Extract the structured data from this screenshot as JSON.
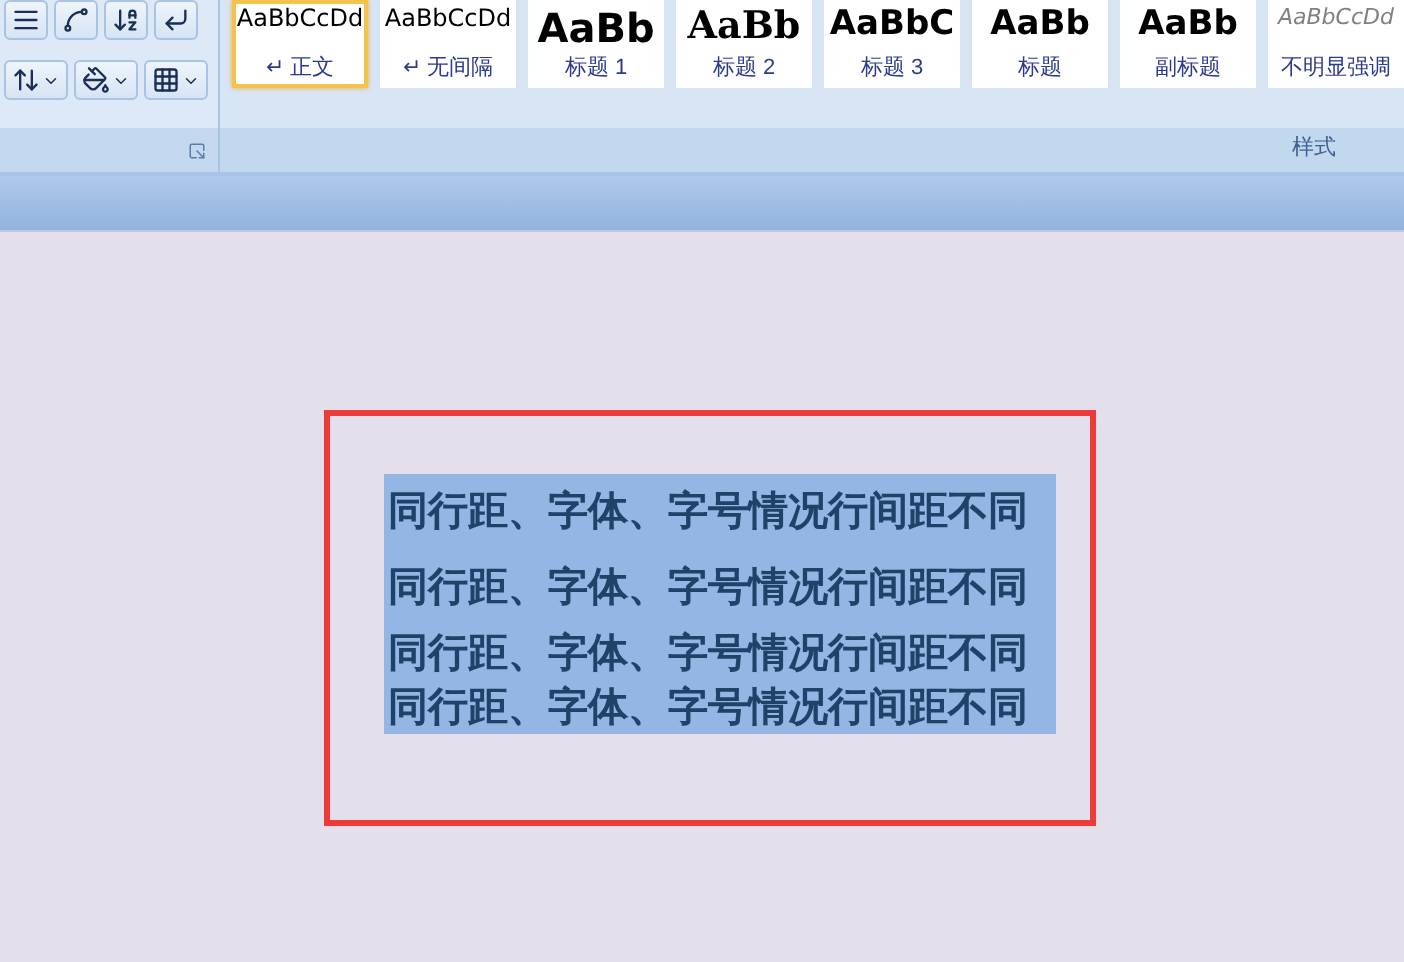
{
  "ribbon": {
    "paragraph_group": {
      "rows": [
        [
          {
            "kind": "justify"
          },
          {
            "kind": "layout"
          },
          {
            "kind": "sort"
          },
          {
            "kind": "marks"
          }
        ],
        [
          {
            "kind": "spacing",
            "dropdown": true
          },
          {
            "kind": "shading",
            "dropdown": true
          },
          {
            "kind": "borders",
            "dropdown": true
          }
        ]
      ]
    },
    "styles_group": {
      "label": "样式",
      "styles": [
        {
          "sample": "AaBbCcDd",
          "label": "↵ 正文",
          "kind": "normal",
          "selected": true
        },
        {
          "sample": "AaBbCcDd",
          "label": "↵ 无间隔",
          "kind": "normal",
          "selected": false
        },
        {
          "sample": "AaBb",
          "label": "标题 1",
          "kind": "heading1",
          "selected": false
        },
        {
          "sample": "AaBb",
          "label": "标题 2",
          "kind": "heading2",
          "selected": false
        },
        {
          "sample": "AaBbC",
          "label": "标题 3",
          "kind": "heading3",
          "selected": false
        },
        {
          "sample": "AaBb",
          "label": "标题",
          "kind": "title",
          "selected": false
        },
        {
          "sample": "AaBb",
          "label": "副标题",
          "kind": "title",
          "selected": false
        },
        {
          "sample": "AaBbCcDd",
          "label": "不明显强调",
          "kind": "subtle",
          "selected": false
        }
      ]
    }
  },
  "document": {
    "lines": [
      {
        "text": "同行距、字体、字号情况行间距不同",
        "kind": "double"
      },
      {
        "text": "同行距、字体、字号情况行间距不同",
        "kind": "one-half"
      },
      {
        "text": "同行距、字体、字号情况行间距不同",
        "kind": "single"
      },
      {
        "text": "同行距、字体、字号情况行间距不同",
        "kind": "single"
      }
    ]
  }
}
